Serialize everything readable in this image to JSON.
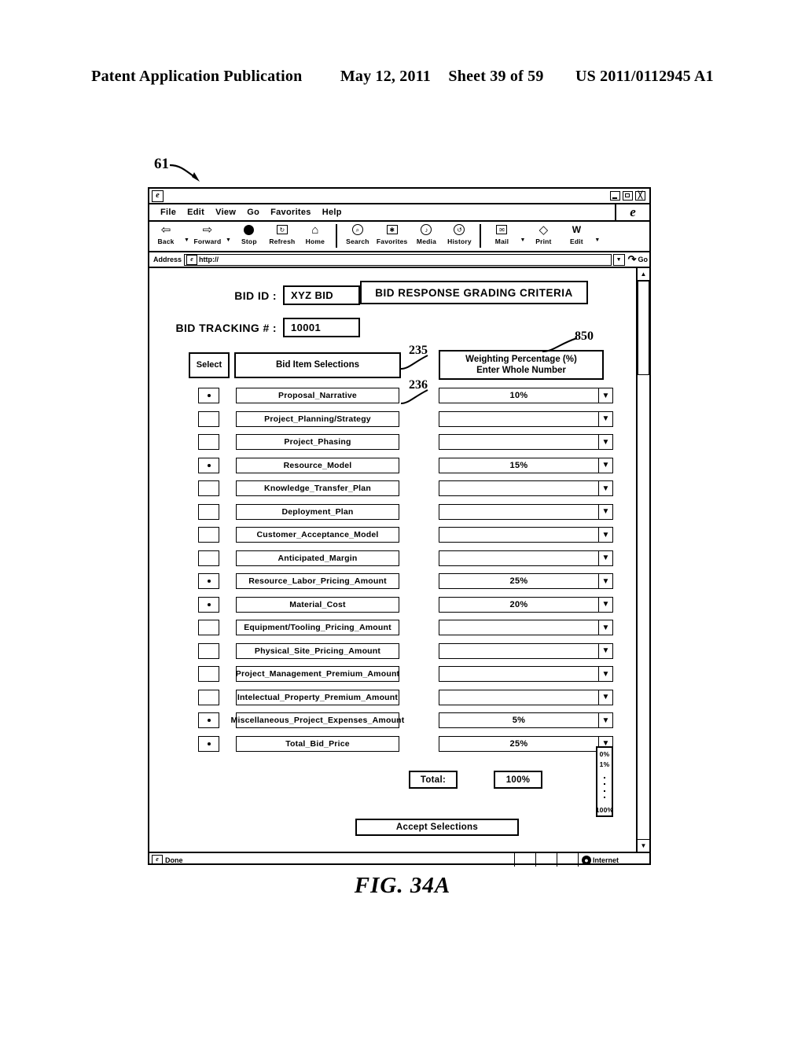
{
  "patent_header": {
    "publication": "Patent Application Publication",
    "date": "May 12, 2011",
    "sheet": "Sheet 39 of 59",
    "number": "US 2011/0112945 A1"
  },
  "figure": {
    "caption": "FIG.  34A",
    "window_ref": "61",
    "bid_items_ref": "235",
    "first_item_ref": "236",
    "weighting_ref": "850"
  },
  "browser": {
    "menus": [
      "File",
      "Edit",
      "View",
      "Go",
      "Favorites",
      "Help"
    ],
    "toolbar": [
      {
        "label": "Back",
        "icon": "left-arrow-icon",
        "glyph": "⇦",
        "caret": true
      },
      {
        "label": "Forward",
        "icon": "right-arrow-icon",
        "glyph": "⇨",
        "caret": true
      },
      {
        "label": "Stop",
        "icon": "stop-icon",
        "glyph": ""
      },
      {
        "label": "Refresh",
        "icon": "refresh-icon",
        "glyph": "↻"
      },
      {
        "label": "Home",
        "icon": "home-icon",
        "glyph": "⌂"
      },
      {
        "label": "Search",
        "icon": "search-icon",
        "glyph": "⌕"
      },
      {
        "label": "Favorites",
        "icon": "star-folder-icon",
        "glyph": "✱"
      },
      {
        "label": "Media",
        "icon": "media-icon",
        "glyph": "♪"
      },
      {
        "label": "History",
        "icon": "history-icon",
        "glyph": "↺"
      },
      {
        "label": "Mail",
        "icon": "mail-icon",
        "glyph": "✉",
        "caret": true
      },
      {
        "label": "Print",
        "icon": "print-icon",
        "glyph": "⎙"
      },
      {
        "label": "Edit",
        "icon": "edit-icon",
        "glyph": "W",
        "caret": true
      }
    ],
    "address": {
      "label": "Address",
      "value": "http://",
      "go_label": "Go"
    },
    "status": {
      "text": "Done",
      "zone": "Internet"
    },
    "title": ""
  },
  "form": {
    "page_title": "BID RESPONSE GRADING CRITERIA",
    "bid_id_label": "BID ID :",
    "bid_id_value": "XYZ BID",
    "bid_tracking_label": "BID TRACKING # :",
    "bid_tracking_value": "10001",
    "col_select": "Select",
    "col_items": "Bid Item Selections",
    "col_weight_line1": "Weighting Percentage (%)",
    "col_weight_line2": "Enter Whole Number",
    "total_label": "Total:",
    "total_value": "100%",
    "accept_label": "Accept Selections",
    "dropdown_options": {
      "first": "0%",
      "second": "1%",
      "last": "100%"
    },
    "rows": [
      {
        "selected": true,
        "name": "Proposal_Narrative",
        "weight": "10%"
      },
      {
        "selected": false,
        "name": "Project_Planning/Strategy",
        "weight": ""
      },
      {
        "selected": false,
        "name": "Project_Phasing",
        "weight": ""
      },
      {
        "selected": true,
        "name": "Resource_Model",
        "weight": "15%"
      },
      {
        "selected": false,
        "name": "Knowledge_Transfer_Plan",
        "weight": ""
      },
      {
        "selected": false,
        "name": "Deployment_Plan",
        "weight": ""
      },
      {
        "selected": false,
        "name": "Customer_Acceptance_Model",
        "weight": ""
      },
      {
        "selected": false,
        "name": "Anticipated_Margin",
        "weight": ""
      },
      {
        "selected": true,
        "name": "Resource_Labor_Pricing_Amount",
        "weight": "25%"
      },
      {
        "selected": true,
        "name": "Material_Cost",
        "weight": "20%"
      },
      {
        "selected": false,
        "name": "Equipment/Tooling_Pricing_Amount",
        "weight": ""
      },
      {
        "selected": false,
        "name": "Physical_Site_Pricing_Amount",
        "weight": ""
      },
      {
        "selected": false,
        "name": "Project_Management_Premium_Amount",
        "weight": ""
      },
      {
        "selected": false,
        "name": "Intelectual_Property_Premium_Amount",
        "weight": ""
      },
      {
        "selected": true,
        "name": "Miscellaneous_Project_Expenses_Amount",
        "weight": "5%"
      },
      {
        "selected": true,
        "name": "Total_Bid_Price",
        "weight": "25%"
      }
    ]
  }
}
